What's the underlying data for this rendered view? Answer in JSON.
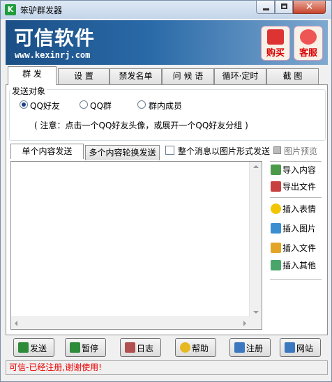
{
  "window": {
    "title": "笨驴群发器"
  },
  "banner": {
    "title": "可信软件",
    "url": "www.kexinrj.com",
    "buy_label": "购买",
    "service_label": "客服"
  },
  "tabs": [
    "群 发",
    "设 置",
    "禁发名单",
    "问 候 语",
    "循环·定时",
    "截 图"
  ],
  "target": {
    "legend": "发送对象",
    "options": [
      "QQ好友",
      "QQ群",
      "群内成员"
    ],
    "selected": "QQ好友",
    "note": "( 注意：点击一个QQ好友头像，或展开一个QQ好友分组 )"
  },
  "content_tabs": [
    "单个内容发送",
    "多个内容轮换发送"
  ],
  "image_mode": {
    "label": "整个消息以图片形式发送",
    "checked": false
  },
  "preview_label": "图片预览",
  "side_actions": [
    "导入内容",
    "导出文件",
    "插入表情",
    "插入图片",
    "插入文件",
    "插入其他"
  ],
  "buttons": [
    "发送",
    "暂停",
    "日志",
    "帮助",
    "注册",
    "网站"
  ],
  "status": "可信-已经注册,谢谢使用!",
  "colors": {
    "banner": "#1b4f86",
    "status_text": "#e00000"
  }
}
